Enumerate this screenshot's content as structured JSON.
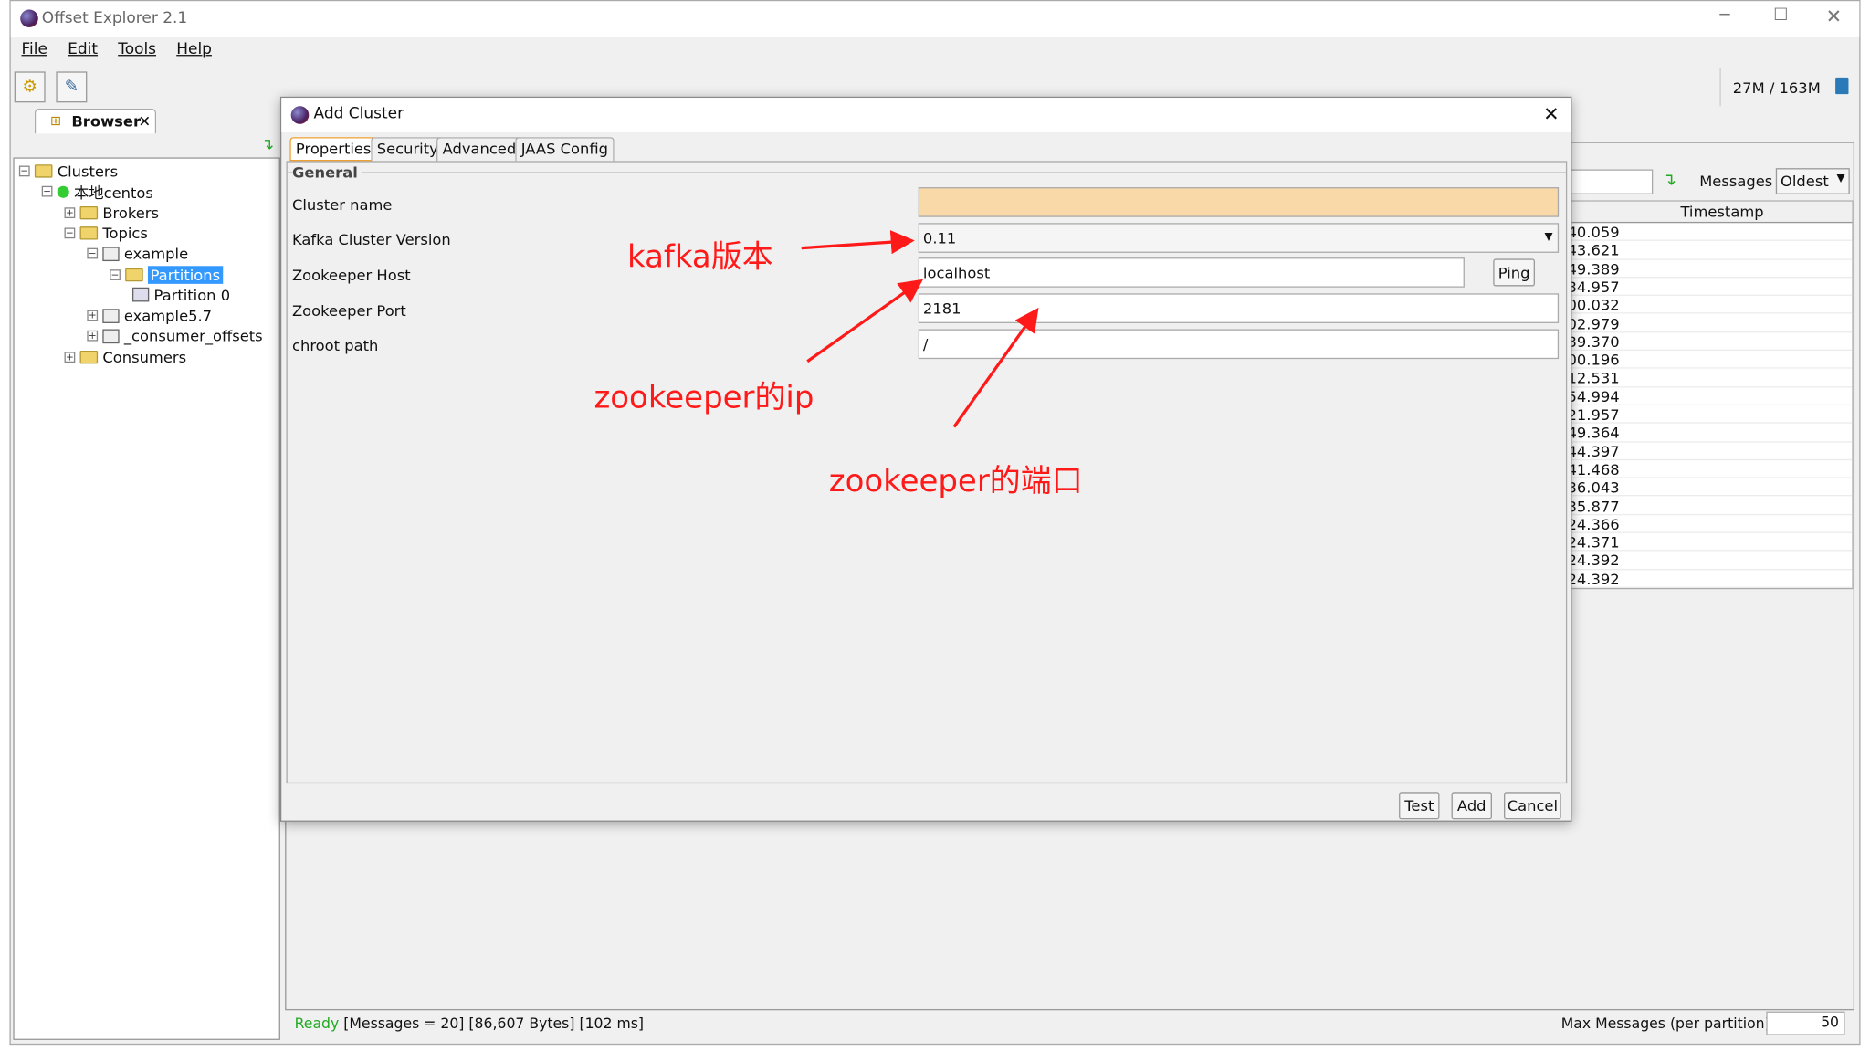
{
  "window": {
    "title": "Offset Explorer  2.1",
    "controls": [
      "minimize",
      "maximize",
      "close"
    ]
  },
  "menu": [
    "File",
    "Edit",
    "Tools",
    "Help"
  ],
  "toolbar": {
    "memory": "27M / 163M"
  },
  "browser": {
    "tab_label": "Browser",
    "tree": [
      {
        "label": "Clusters",
        "level": 0,
        "expanded": true,
        "icon": "folder-open-icon"
      },
      {
        "label": "本地centos",
        "level": 1,
        "expanded": true,
        "icon": "connected-green-dot-icon"
      },
      {
        "label": "Brokers",
        "level": 2,
        "expanded": false,
        "icon": "folder-icon"
      },
      {
        "label": "Topics",
        "level": 2,
        "expanded": true,
        "icon": "folder-open-icon"
      },
      {
        "label": "example",
        "level": 3,
        "expanded": true,
        "icon": "topic-icon"
      },
      {
        "label": "Partitions",
        "level": 4,
        "expanded": true,
        "icon": "folder-open-icon",
        "selected": true
      },
      {
        "label": "Partition 0",
        "level": 5,
        "icon": "partition-icon"
      },
      {
        "label": "example5.7",
        "level": 3,
        "expanded": false,
        "icon": "topic-icon"
      },
      {
        "label": "_consumer_offsets",
        "level": 3,
        "expanded": false,
        "icon": "topic-icon"
      },
      {
        "label": "Consumers",
        "level": 2,
        "expanded": false,
        "icon": "folder-icon"
      }
    ]
  },
  "messages": {
    "label": "Messages",
    "order": "Oldest",
    "column": "Timestamp",
    "timestamps": [
      ":40.059",
      ":43.621",
      ":49.389",
      ":34.957",
      ":00.032",
      ":02.979",
      ":39.370",
      ":00.196",
      ":12.531",
      ":54.994",
      ":21.957",
      ":49.364",
      ":44.397",
      ":41.468",
      ":36.043",
      ":35.877",
      ":24.366",
      ":24.371",
      ":24.392",
      ":24.392"
    ]
  },
  "status": {
    "ready": "Ready",
    "messages": "[Messages = 20]",
    "bytes": "[86,607 Bytes]",
    "time": "[102 ms]",
    "max_label": "Max Messages (per partition)",
    "max_value": "50"
  },
  "dialog": {
    "title": "Add Cluster",
    "tabs": [
      "Properties",
      "Security",
      "Advanced",
      "JAAS Config"
    ],
    "group": "General",
    "fields": {
      "cluster_name": {
        "label": "Cluster name",
        "value": ""
      },
      "version": {
        "label": "Kafka Cluster Version",
        "value": "0.11"
      },
      "host": {
        "label": "Zookeeper Host",
        "value": "localhost"
      },
      "port": {
        "label": "Zookeeper Port",
        "value": "2181"
      },
      "chroot": {
        "label": "chroot path",
        "value": "/"
      }
    },
    "ping": "Ping",
    "test": "Test",
    "add": "Add",
    "cancel": "Cancel"
  },
  "annotations": {
    "version": "kafka版本",
    "ip": "zookeeper的ip",
    "port": "zookeeper的端口"
  },
  "colors": {
    "annotation": "#ff1a1a",
    "required_field": "#fad9a8",
    "selection": "#3399ff",
    "ready": "#22aa22"
  }
}
